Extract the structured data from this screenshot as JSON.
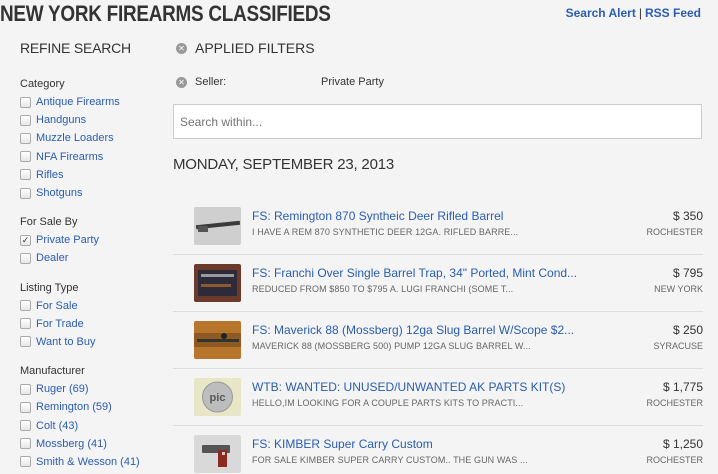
{
  "header": {
    "title": "NEW YORK FIREARMS CLASSIFIEDS",
    "search_alert": "Search Alert",
    "separator": "|",
    "rss_feed": "RSS Feed"
  },
  "sidebar": {
    "title": "REFINE SEARCH",
    "groups": [
      {
        "title": "Category",
        "options": [
          {
            "label": "Antique Firearms",
            "checked": false
          },
          {
            "label": "Handguns",
            "checked": false
          },
          {
            "label": "Muzzle Loaders",
            "checked": false
          },
          {
            "label": "NFA Firearms",
            "checked": false
          },
          {
            "label": "Rifles",
            "checked": false
          },
          {
            "label": "Shotguns",
            "checked": false
          }
        ]
      },
      {
        "title": "For Sale By",
        "options": [
          {
            "label": "Private Party",
            "checked": true
          },
          {
            "label": "Dealer",
            "checked": false
          }
        ]
      },
      {
        "title": "Listing Type",
        "options": [
          {
            "label": "For Sale",
            "checked": false
          },
          {
            "label": "For Trade",
            "checked": false
          },
          {
            "label": "Want to Buy",
            "checked": false
          }
        ]
      },
      {
        "title": "Manufacturer",
        "options": [
          {
            "label": "Ruger (69)",
            "checked": false
          },
          {
            "label": "Remington (59)",
            "checked": false
          },
          {
            "label": "Colt (43)",
            "checked": false
          },
          {
            "label": "Mossberg (41)",
            "checked": false
          },
          {
            "label": "Smith & Wesson (41)",
            "checked": false
          }
        ]
      }
    ]
  },
  "main": {
    "applied_filters": "APPLIED FILTERS",
    "filter_label": "Seller:",
    "filter_value": "Private Party",
    "search_placeholder": "Search within...",
    "date_heading": "MONDAY, SEPTEMBER 23, 2013"
  },
  "listings": [
    {
      "title": "FS: Remington 870 Syntheic Deer Rifled Barrel",
      "desc": "I HAVE A REM 870 SYNTHETIC DEER 12GA. RIFLED BARRE...",
      "price": "$ 350",
      "city": "ROCHESTER",
      "thumb": "barrel"
    },
    {
      "title": "FS: Franchi Over Single Barrel Trap, 34\" Ported, Mint Cond...",
      "desc": "REDUCED FROM $850 TO $795 A. LUGI FRANCHI (SOME T...",
      "price": "$ 795",
      "city": "NEW YORK",
      "thumb": "case"
    },
    {
      "title": "FS: Maverick 88 (Mossberg) 12ga Slug Barrel W/Scope $2...",
      "desc": "MAVERICK 88 (MOSSBERG 500) PUMP 12GA SLUG BARREL W...",
      "price": "$ 250",
      "city": "SYRACUSE",
      "thumb": "wood"
    },
    {
      "title": "WTB: WANTED: UNUSED/UNWANTED AK PARTS KIT(S)",
      "desc": "HELLO,IM LOOKING FOR A COUPLE PARTS KITS TO PRACTI...",
      "price": "$ 1,775",
      "city": "ROCHESTER",
      "thumb": "pic"
    },
    {
      "title": "FS: KIMBER Super Carry Custom",
      "desc": "FOR SALE KIMBER SUPER CARRY CUSTOM.. THE GUN WAS ...",
      "price": "$ 1,250",
      "city": "ROCHESTER",
      "thumb": "pistol"
    }
  ]
}
